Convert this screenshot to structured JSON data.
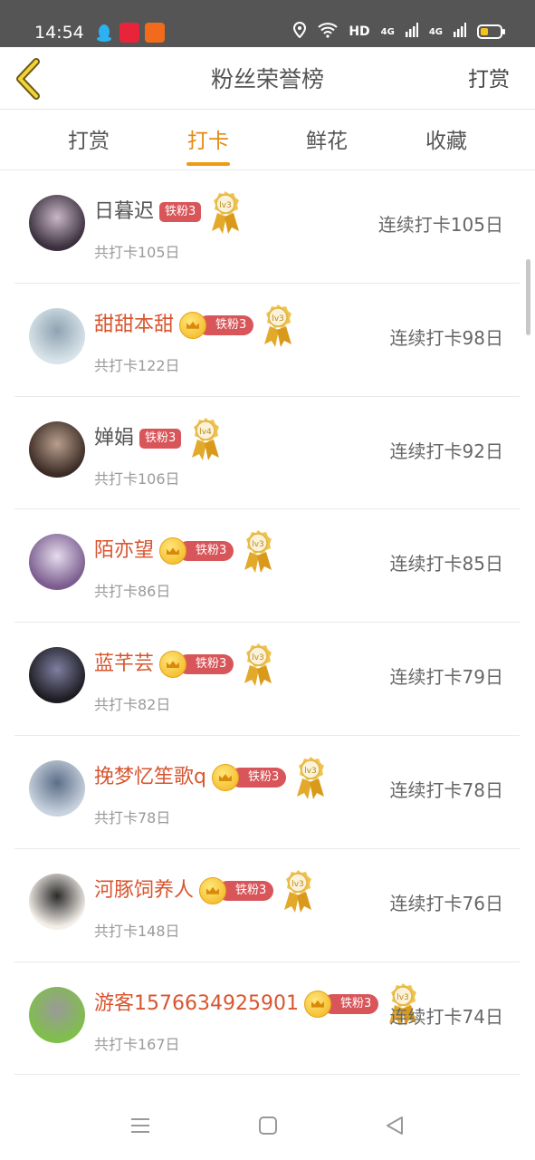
{
  "status_bar": {
    "time": "14:54",
    "network_label": "HD",
    "signal1_label": "4G",
    "signal2_label": "4G"
  },
  "header": {
    "title": "粉丝荣誉榜",
    "right_action": "打赏",
    "back_icon": "chevron-left-icon"
  },
  "tabs": [
    {
      "label": "打赏",
      "active": false
    },
    {
      "label": "打卡",
      "active": true
    },
    {
      "label": "鲜花",
      "active": false
    },
    {
      "label": "收藏",
      "active": false
    }
  ],
  "accent_color": "#ef9a17",
  "vip_name_color": "#d8552f",
  "fans": [
    {
      "name": "日暮迟",
      "vip": false,
      "badge": "铁粉3",
      "medal": "lv3",
      "total": "共打卡105日",
      "streak": "连续打卡105日"
    },
    {
      "name": "甜甜本甜",
      "vip": true,
      "badge": "铁粉3",
      "medal": "lv3",
      "total": "共打卡122日",
      "streak": "连续打卡98日"
    },
    {
      "name": "婵娟",
      "vip": false,
      "badge": "铁粉3",
      "medal": "lv4",
      "total": "共打卡106日",
      "streak": "连续打卡92日"
    },
    {
      "name": "陌亦望",
      "vip": true,
      "badge": "铁粉3",
      "medal": "lv3",
      "total": "共打卡86日",
      "streak": "连续打卡85日"
    },
    {
      "name": "蓝芊芸",
      "vip": true,
      "badge": "铁粉3",
      "medal": "lv3",
      "total": "共打卡82日",
      "streak": "连续打卡79日"
    },
    {
      "name": "挽梦忆笙歌q",
      "vip": true,
      "badge": "铁粉3",
      "medal": "lv3",
      "total": "共打卡78日",
      "streak": "连续打卡78日"
    },
    {
      "name": "河豚饲养人",
      "vip": true,
      "badge": "铁粉3",
      "medal": "lv3",
      "total": "共打卡148日",
      "streak": "连续打卡76日"
    },
    {
      "name": "游客1576634925901",
      "vip": true,
      "badge": "铁粉3",
      "medal": "lv3",
      "total": "共打卡167日",
      "streak": "连续打卡74日"
    }
  ]
}
